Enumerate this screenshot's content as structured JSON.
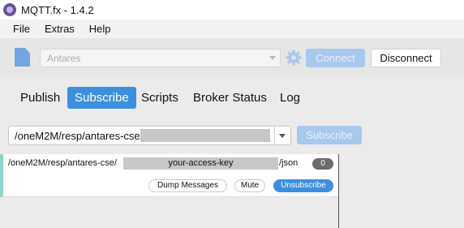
{
  "window": {
    "title": "MQTT.fx - 1.4.2",
    "app_icon": "mqttfx-logo-icon"
  },
  "menu": {
    "items": [
      "File",
      "Extras",
      "Help"
    ]
  },
  "toolbar": {
    "broker_profile": "Antares",
    "connect_label": "Connect",
    "disconnect_label": "Disconnect",
    "icons": {
      "profile": "document-icon",
      "settings": "gear-icon"
    }
  },
  "tabs": [
    {
      "label": "Publish",
      "active": false
    },
    {
      "label": "Subscribe",
      "active": true
    },
    {
      "label": "Scripts",
      "active": false
    },
    {
      "label": "Broker Status",
      "active": false
    },
    {
      "label": "Log",
      "active": false
    }
  ],
  "subscribe": {
    "topic_value": "/oneM2M/resp/antares-cse/",
    "subscribe_label": "Subscribe"
  },
  "subscriptions": [
    {
      "topic_prefix": "/oneM2M/resp/antares-cse/",
      "redacted_key": "your-access-key",
      "topic_suffix": "/json",
      "message_count": "0",
      "dump_label": "Dump Messages",
      "mute_label": "Mute",
      "unsubscribe_label": "Unsubscribe"
    }
  ],
  "colors": {
    "accent": "#3c8fdd",
    "accent_disabled": "#a9c8ee",
    "card_marker": "#8fd3cf"
  }
}
